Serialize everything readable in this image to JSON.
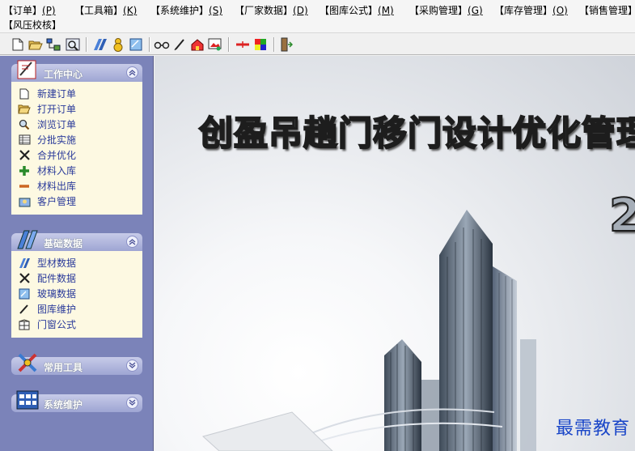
{
  "menubar": {
    "items": [
      {
        "label": "【订单】",
        "accel": "(P)"
      },
      {
        "label": "【工具箱】",
        "accel": "(K)"
      },
      {
        "label": "【系统维护】",
        "accel": "(S)"
      },
      {
        "label": "【厂家数据】",
        "accel": "(D)"
      },
      {
        "label": "【图库公式】",
        "accel": "(M)"
      },
      {
        "label": "【采购管理】",
        "accel": "(G)"
      },
      {
        "label": "【库存管理】",
        "accel": "(O)"
      },
      {
        "label": "【销售管理】",
        "accel": ""
      },
      {
        "label": "【风压校核】",
        "accel": ""
      }
    ]
  },
  "toolbar": {
    "icons": [
      "new-file-icon",
      "open-folder-icon",
      "tree-icon",
      "preview-icon",
      "material-icon",
      "gourd-icon",
      "glass-icon",
      "glasses-icon",
      "pen-icon",
      "house-icon",
      "image-edit-icon",
      "cut-line-icon",
      "color-grid-icon",
      "exit-door-icon"
    ]
  },
  "sidebar": {
    "groups": [
      {
        "title": "工作中心",
        "items": [
          {
            "label": "新建订单",
            "icon": "new-doc-icon"
          },
          {
            "label": "打开订单",
            "icon": "open-folder-icon"
          },
          {
            "label": "浏览订单",
            "icon": "magnifier-icon"
          },
          {
            "label": "分批实施",
            "icon": "table-icon"
          },
          {
            "label": "合并优化",
            "icon": "tools-icon"
          },
          {
            "label": "材料入库",
            "icon": "plus-icon"
          },
          {
            "label": "材料出库",
            "icon": "minus-icon"
          },
          {
            "label": "客户管理",
            "icon": "customer-icon"
          }
        ]
      },
      {
        "title": "基础数据",
        "items": [
          {
            "label": "型材数据",
            "icon": "profile-icon"
          },
          {
            "label": "配件数据",
            "icon": "tools-icon"
          },
          {
            "label": "玻璃数据",
            "icon": "glass-icon"
          },
          {
            "label": "图库维护",
            "icon": "pen-icon"
          },
          {
            "label": "门窗公式",
            "icon": "window-icon"
          }
        ]
      },
      {
        "title": "常用工具",
        "items": []
      },
      {
        "title": "系统维护",
        "items": []
      }
    ]
  },
  "splash": {
    "title": "创盈吊趟门移门设计优化管理系统",
    "version_fragment": "2"
  },
  "watermark": "最需教育",
  "colors": {
    "panel_bg": "#7b83b9",
    "group_body": "#fdf9e2",
    "nav_text": "#2a3a9a",
    "watermark": "#1a46c8"
  }
}
